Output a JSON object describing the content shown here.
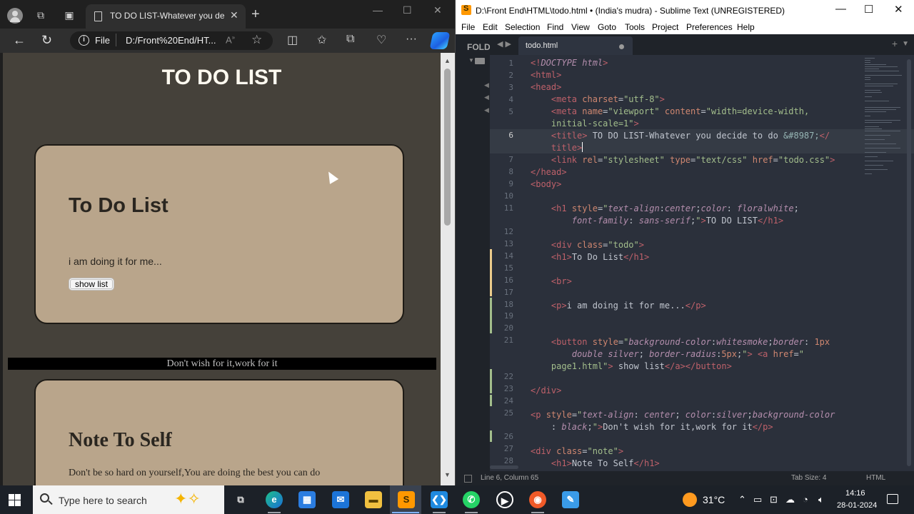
{
  "browser": {
    "tab_title": "TO DO LIST-Whatever you decide",
    "tab_close": "✕",
    "new_tab": "+",
    "url_scheme": "File",
    "url": "D:/Front%20End/HT...",
    "window_controls": [
      "—",
      "☐",
      "✕"
    ]
  },
  "webpage": {
    "heading": "TO DO LIST",
    "card1_title": "To Do List",
    "card1_text": "i am doing it for me...",
    "show_button": "show list",
    "motto": "Don't wish for it,work for it",
    "card2_title": "Note To Self",
    "card2_text": "Don't be so hard on yourself,You are doing the best you can do"
  },
  "sublime": {
    "title": "D:\\Front End\\HTML\\todo.html • (India's mudra) - Sublime Text (UNREGISTERED)",
    "menu": [
      "File",
      "Edit",
      "Selection",
      "Find",
      "View",
      "Goto",
      "Tools",
      "Project",
      "Preferences",
      "Help"
    ],
    "sidebar_label": "FOLD",
    "tab_name": "todo.html",
    "status_position": "Line 6, Column 65",
    "status_tab_size": "Tab Size: 4",
    "status_syntax": "HTML",
    "line_numbers": [
      "1",
      "2",
      "3",
      "4",
      "5",
      "6",
      "7",
      "8",
      "9",
      "10",
      "11",
      "12",
      "13",
      "14",
      "15",
      "16",
      "17",
      "18",
      "19",
      "20",
      "21",
      "22",
      "23",
      "24",
      "25",
      "26",
      "27",
      "28"
    ]
  },
  "taskbar": {
    "search_placeholder": "Type here to search",
    "weather": "31°C",
    "time": "14:16",
    "date": "28-01-2024",
    "icons": [
      "task-view-icon",
      "edge-icon",
      "store-icon",
      "mail-icon",
      "file-explorer-icon",
      "sublime-text-icon",
      "vscode-icon",
      "whatsapp-icon",
      "media-player-icon",
      "media-icon",
      "paint-icon"
    ]
  },
  "colors": {
    "page_bg": "#45413a",
    "card_bg": "#b9a58b",
    "heading": "#fffaf0",
    "editor_bg": "#2b303b",
    "sublime_accent": "#ff9800"
  }
}
